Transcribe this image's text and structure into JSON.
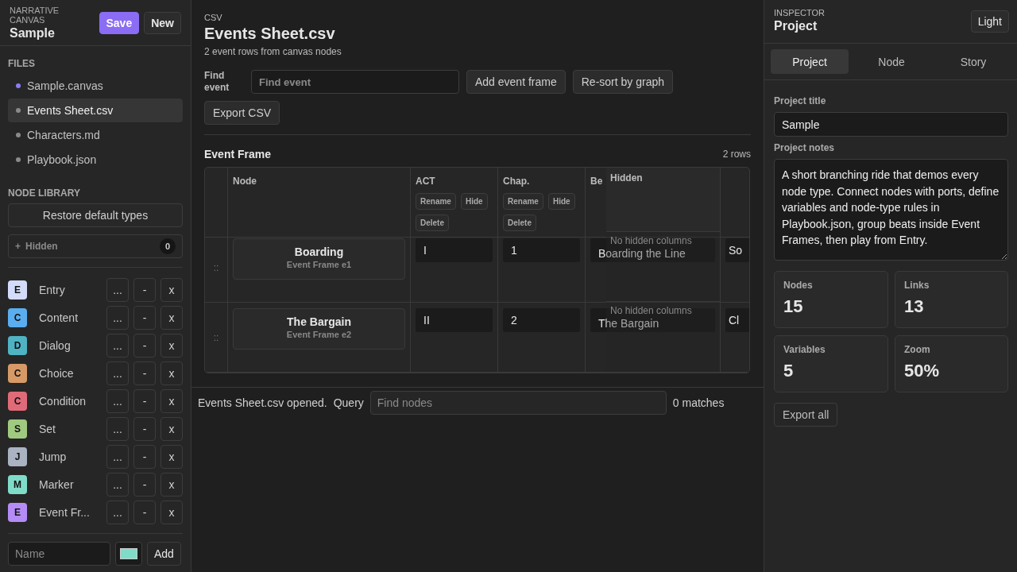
{
  "app": {
    "brand": "NARRATIVE CANVAS",
    "project": "Sample",
    "buttons": [
      {
        "label": "Save",
        "kind": "primary"
      },
      {
        "label": "New",
        "kind": "plain"
      }
    ]
  },
  "files": {
    "heading": "FILES",
    "items": [
      {
        "name": "Sample.canvas",
        "selected": false,
        "color": "#8b7cf6"
      },
      {
        "name": "Events Sheet.csv",
        "selected": true,
        "color": "#8a8a8a"
      },
      {
        "name": "Characters.md",
        "selected": false,
        "color": "#8a8a8a"
      },
      {
        "name": "Playbook.json",
        "selected": false,
        "color": "#8a8a8a"
      }
    ]
  },
  "node_library": {
    "heading": "NODE LIBRARY",
    "restore": "Restore default types",
    "hidden": {
      "toggle": "+",
      "label": "Hidden",
      "count": "0"
    },
    "types": [
      {
        "letter": "E",
        "name": "Entry",
        "color": "#d3dcfa",
        "actions": [
          "...",
          "-",
          "x"
        ]
      },
      {
        "letter": "C",
        "name": "Content",
        "color": "#5aaeef",
        "actions": [
          "...",
          "-",
          "x"
        ]
      },
      {
        "letter": "D",
        "name": "Dialog",
        "color": "#4fb3c3",
        "actions": [
          "...",
          "-",
          "x"
        ]
      },
      {
        "letter": "C",
        "name": "Choice",
        "color": "#d79a66",
        "actions": [
          "...",
          "-",
          "x"
        ]
      },
      {
        "letter": "C",
        "name": "Condition",
        "color": "#e06b78",
        "actions": [
          "...",
          "-",
          "x"
        ]
      },
      {
        "letter": "S",
        "name": "Set",
        "color": "#9fca7f",
        "actions": [
          "...",
          "-",
          "x"
        ]
      },
      {
        "letter": "J",
        "name": "Jump",
        "color": "#aab3c2",
        "actions": [
          "...",
          "-",
          "x"
        ]
      },
      {
        "letter": "M",
        "name": "Marker",
        "color": "#7fdcc8",
        "actions": [
          "...",
          "-",
          "x"
        ]
      },
      {
        "letter": "E",
        "name": "Event Fr...",
        "color": "#b58cf6",
        "actions": [
          "...",
          "-",
          "x"
        ]
      }
    ],
    "new_type": {
      "placeholder": "Name",
      "color": "#7fdcc8",
      "button": "Add"
    }
  },
  "document": {
    "kind_label": "CSV",
    "title": "Events Sheet.csv",
    "subtitle": "2 event rows from canvas nodes",
    "find_label": "Find event",
    "find_placeholder": "Find event",
    "buttons": [
      "Add event frame",
      "Re-sort by graph",
      "Export CSV"
    ]
  },
  "table": {
    "title": "Event Frame",
    "count": "2 rows",
    "columns": [
      {
        "label": "Node"
      },
      {
        "label": "ACT",
        "actions": [
          "Rename",
          "Hide",
          "Delete"
        ]
      },
      {
        "label": "Chap.",
        "actions": [
          "Rename",
          "Hide",
          "Delete"
        ]
      },
      {
        "label": "Be"
      }
    ],
    "hidden_panel": {
      "title": "Hidden"
    },
    "rows": [
      {
        "handle": "::",
        "cells": [
          {
            "kind": "node",
            "title": "Boarding",
            "subtitle": "Event Frame e1"
          },
          {
            "kind": "text",
            "value": "I"
          },
          {
            "kind": "text",
            "value": "1"
          },
          {
            "kind": "text",
            "value": "Boarding the Line"
          },
          {
            "kind": "text",
            "value": "So"
          }
        ],
        "hidden_note": "No hidden columns"
      },
      {
        "handle": "::",
        "cells": [
          {
            "kind": "node",
            "title": "The Bargain",
            "subtitle": "Event Frame e2"
          },
          {
            "kind": "text",
            "value": "II"
          },
          {
            "kind": "text",
            "value": "2"
          },
          {
            "kind": "text",
            "value": "The Bargain"
          },
          {
            "kind": "text",
            "value": "Cl"
          }
        ],
        "hidden_note": "No hidden columns"
      }
    ]
  },
  "status_bar": {
    "message": "Events Sheet.csv opened.",
    "query_label": "Query",
    "query_placeholder": "Find nodes",
    "matches": "0 matches"
  },
  "inspector": {
    "label": "INSPECTOR",
    "title": "Project",
    "theme_button": "Light",
    "tabs": [
      {
        "label": "Project",
        "selected": true
      },
      {
        "label": "Node",
        "selected": false
      },
      {
        "label": "Story",
        "selected": false
      }
    ],
    "fields": [
      {
        "kind": "input",
        "label": "Project title",
        "value": "Sample"
      },
      {
        "kind": "textarea",
        "label": "Project notes",
        "value": "A short branching ride that demos every node type. Connect nodes with ports, define variables and node-type rules in Playbook.json, group beats inside Event Frames, then play from Entry."
      }
    ],
    "stats": [
      {
        "label": "Nodes",
        "value": "15"
      },
      {
        "label": "Links",
        "value": "13"
      },
      {
        "label": "Variables",
        "value": "5"
      },
      {
        "label": "Zoom",
        "value": "50%"
      }
    ],
    "export": "Export all"
  }
}
